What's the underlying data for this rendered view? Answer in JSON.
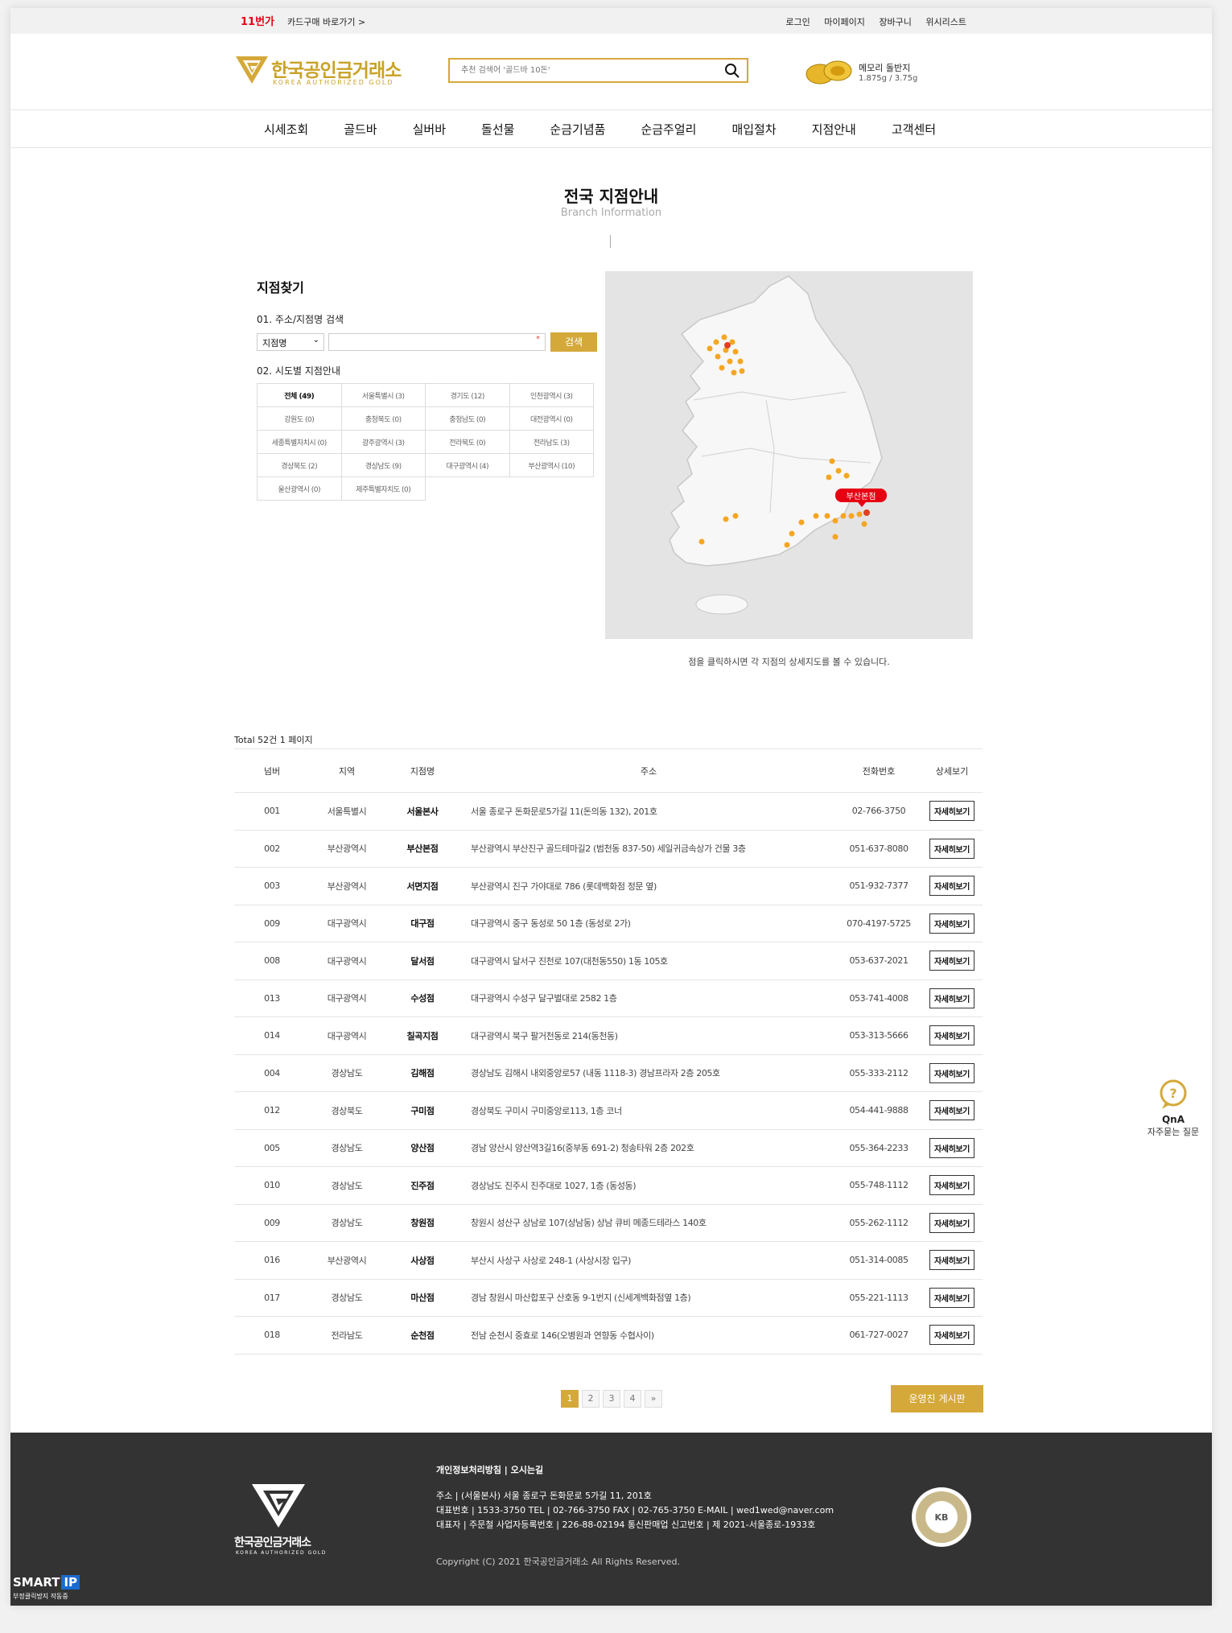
{
  "topbar": {
    "brand_badge": "11번가",
    "card_link": "카드구매 바로가기 >",
    "links": [
      "로그인",
      "마이페이지",
      "장바구니",
      "위시리스트"
    ]
  },
  "header": {
    "logo_name": "한국공인금거래소",
    "logo_sub": "KOREA AUTHORIZED GOLD",
    "search_placeholder": "추천 검색어 '골드바 10돈'",
    "promo_title": "메모리 돌반지",
    "promo_sub": "1.875g / 3.75g"
  },
  "nav": [
    "시세조회",
    "골드바",
    "실버바",
    "돌선물",
    "순금기념품",
    "순금주얼리",
    "매입절차",
    "지점안내",
    "고객센터"
  ],
  "page": {
    "title": "전국 지점안내",
    "subtitle": "Branch Information"
  },
  "finder": {
    "title": "지점찾기",
    "step1": "01. 주소/지점명 검색",
    "select_value": "지점명",
    "search_button": "검색",
    "step2": "02. 시도별 지점안내",
    "regions": [
      "전체 (49)",
      "서울특별시 (3)",
      "경기도 (12)",
      "인천광역시 (3)",
      "강원도 (0)",
      "충청북도 (0)",
      "충청남도 (0)",
      "대전광역시 (0)",
      "세종특별자치시 (0)",
      "광주광역시 (3)",
      "전라북도 (0)",
      "전라남도 (3)",
      "경상북도 (2)",
      "경상남도 (9)",
      "대구광역시 (4)",
      "부산광역시 (10)",
      "울산광역시 (0)",
      "제주특별자치도 (0)"
    ]
  },
  "map": {
    "callout": "부산본점",
    "note": "점을 클릭하시면 각 지점의 상세지도를 볼 수 있습니다."
  },
  "list": {
    "total": "Total 52건 1 페이지",
    "headers": [
      "넘버",
      "지역",
      "지점명",
      "주소",
      "전화번호",
      "상세보기"
    ],
    "detail_label": "자세히보기",
    "rows": [
      [
        "001",
        "서울특별시",
        "서울본사",
        "서울 종로구 돈화문로5가길 11(돈의동 132), 201호",
        "02-766-3750"
      ],
      [
        "002",
        "부산광역시",
        "부산본점",
        "부산광역시 부산진구 골드테마길2 (범천동 837-50) 세일귀금속상가 건물 3층",
        "051-637-8080"
      ],
      [
        "003",
        "부산광역시",
        "서면지점",
        "부산광역시 진구 가야대로 786 (롯데백화점 정문 옆)",
        "051-932-7377"
      ],
      [
        "009",
        "대구광역시",
        "대구점",
        "대구광역시 중구 동성로 50 1층 (동성로 2가)",
        "070-4197-5725"
      ],
      [
        "008",
        "대구광역시",
        "달서점",
        "대구광역시 달서구 진천로 107(대천동550) 1동 105호",
        "053-637-2021"
      ],
      [
        "013",
        "대구광역시",
        "수성점",
        "대구광역시 수성구 달구벌대로 2582 1층",
        "053-741-4008"
      ],
      [
        "014",
        "대구광역시",
        "칠곡지점",
        "대구광역시 북구 팔거천동로 214(동천동)",
        "053-313-5666"
      ],
      [
        "004",
        "경상남도",
        "김해점",
        "경상남도 김해시 내외중앙로57 (내동 1118-3) 경남프라자 2층 205호",
        "055-333-2112"
      ],
      [
        "012",
        "경상북도",
        "구미점",
        "경상북도 구미시 구미중앙로113, 1층 코너",
        "054-441-9888"
      ],
      [
        "005",
        "경상남도",
        "양산점",
        "경남 양산시 양산역3길16(중부동 691-2) 청송타워 2층 202호",
        "055-364-2233"
      ],
      [
        "010",
        "경상남도",
        "진주점",
        "경상남도 진주시 진주대로 1027, 1층 (동성동)",
        "055-748-1112"
      ],
      [
        "009",
        "경상남도",
        "창원점",
        "창원시 성산구 상남로 107(상남동) 상남 큐비 메종드테라스 140호",
        "055-262-1112"
      ],
      [
        "016",
        "부산광역시",
        "사상점",
        "부산시 사상구 사상로 248-1 (사상시장 입구)",
        "051-314-0085"
      ],
      [
        "017",
        "경상남도",
        "마산점",
        "경남 창원시 마산합포구 산호동 9-1번지 (신세계백화점옆 1층)",
        "055-221-1113"
      ],
      [
        "018",
        "전라남도",
        "순천점",
        "전남 순천시 중효로 146(오병원과 연향동 수협사이)",
        "061-727-0027"
      ]
    ]
  },
  "pager": {
    "pages": [
      "1",
      "2",
      "3",
      "4",
      "»"
    ],
    "board_button": "운영진 게시판"
  },
  "qna": {
    "title": "QnA",
    "sub": "자주묻는 질문"
  },
  "footer": {
    "links": "개인정보처리방침 | 오시는길",
    "logo_name": "한국공인금거래소",
    "logo_sub": "KOREA AUTHORIZED GOLD",
    "line1": "주소 | (서울본사) 서울 종로구 돈화문로 5가길 11, 201호",
    "line2": "대표번호 | 1533-3750   TEL | 02-766-3750   FAX | 02-765-3750   E-MAIL | wed1wed@naver.com",
    "line3": "대표자 | 주문철   사업자등록번호 | 226-88-02194   통신판매업 신고번호 | 제 2021-서울종로-1933호",
    "copyright": "Copyright (C) 2021 한국공인금거래소 All Rights Reserved.",
    "smart_title": "SMART",
    "smart_badge": "IP",
    "smart_sub": "부정클릭방지 작동중"
  }
}
